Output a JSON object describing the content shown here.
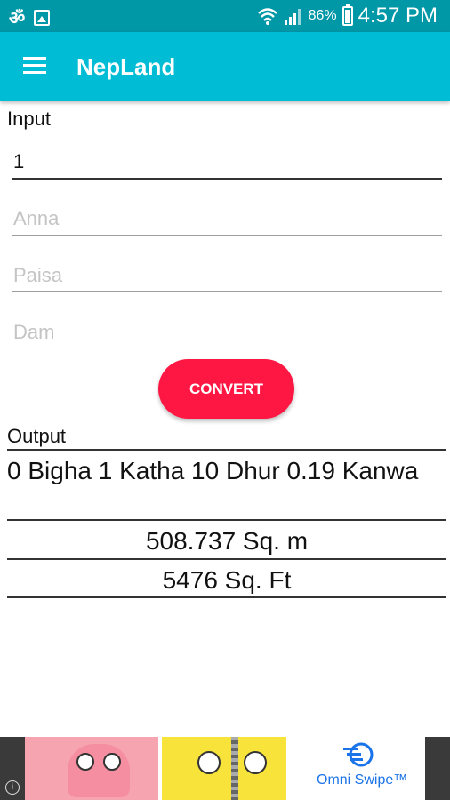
{
  "status_bar": {
    "om_symbol": "ॐ",
    "battery_percent": "86%",
    "battery_level": 0.86,
    "time": "4:57 PM",
    "icons": [
      "om-icon",
      "image-icon",
      "wifi-icon",
      "signal-icon",
      "battery-charging-icon"
    ]
  },
  "app_bar": {
    "title": "NepLand",
    "menu_icon": "hamburger-menu-icon"
  },
  "form": {
    "input_label": "Input",
    "fields": [
      {
        "value": "1",
        "placeholder": ""
      },
      {
        "value": "",
        "placeholder": "Anna"
      },
      {
        "value": "",
        "placeholder": "Paisa"
      },
      {
        "value": "",
        "placeholder": "Dam"
      }
    ],
    "convert_label": "CONVERT"
  },
  "output": {
    "label": "Output",
    "nepali_units": "0 Bigha 1 Katha 10 Dhur 0.19 Kanwa",
    "square_meters": "508.737 Sq. m",
    "square_feet": "5476 Sq. Ft"
  },
  "ad": {
    "brand": "Omni Swipe™",
    "info_glyph": "i"
  },
  "colors": {
    "status_bar": "#0097a7",
    "app_bar": "#00bcd4",
    "convert_button": "#ff1744"
  }
}
